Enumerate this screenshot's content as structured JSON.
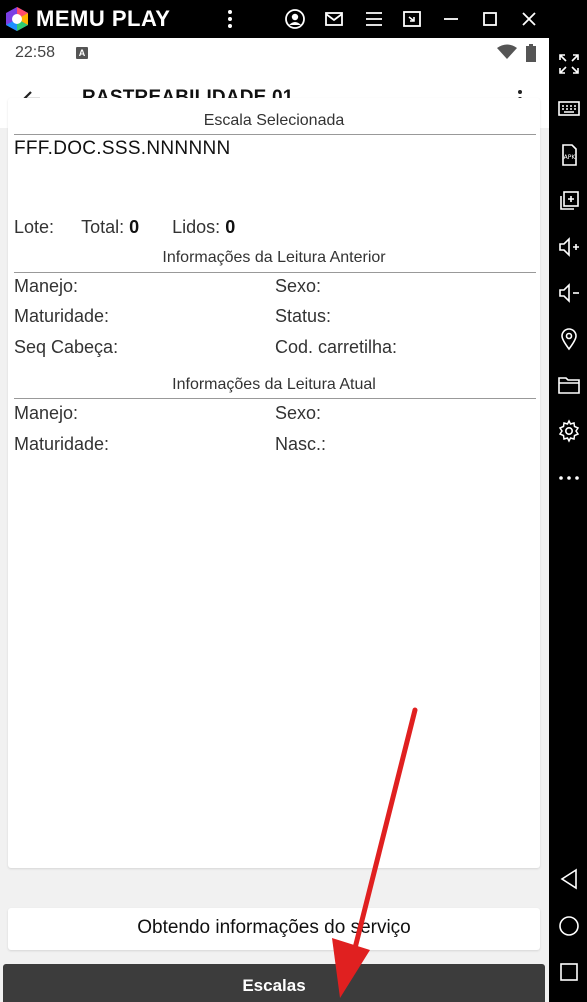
{
  "emulator": {
    "brand": "MEMU PLAY",
    "topbar_icons": [
      "more-vert-icon",
      "account-icon",
      "mail-icon",
      "menu-icon",
      "screen-cast-icon",
      "minimize-icon",
      "maximize-icon",
      "close-icon"
    ],
    "sidebar_icons": [
      "fullscreen-icon",
      "keyboard-icon",
      "apk-icon",
      "multi-window-icon",
      "volume-up-icon",
      "volume-down-icon",
      "location-icon",
      "folder-icon",
      "settings-icon",
      "more-horiz-icon",
      "android-back-icon",
      "android-home-icon",
      "android-recents-icon"
    ]
  },
  "status_bar": {
    "time": "22:58",
    "notification_letter": "A"
  },
  "app_bar": {
    "title": "RASTREABILIDADE 01"
  },
  "selected_scale": {
    "section_title": "Escala Selecionada",
    "code": "FFF.DOC.SSS.NNNNNN"
  },
  "counts": {
    "lote_label": "Lote:",
    "lote_value": "",
    "total_label": "Total:",
    "total_value": "0",
    "lidos_label": "Lidos:",
    "lidos_value": "0"
  },
  "previous_reading": {
    "section_title": "Informações da Leitura Anterior",
    "manejo": "Manejo:",
    "sexo": "Sexo:",
    "maturidade": "Maturidade:",
    "status": "Status:",
    "seq_cabeca": "Seq Cabeça:",
    "cod_carretilha": "Cod. carretilha:"
  },
  "current_reading": {
    "section_title": "Informações da Leitura Atual",
    "manejo": "Manejo:",
    "sexo": "Sexo:",
    "maturidade": "Maturidade:",
    "nasc": "Nasc.:"
  },
  "service_status": "Obtendo informações do serviço",
  "escalas_button": "Escalas",
  "colors": {
    "topbar": "#000000",
    "button": "#3c3c3c",
    "annotation_arrow": "#e02020"
  }
}
